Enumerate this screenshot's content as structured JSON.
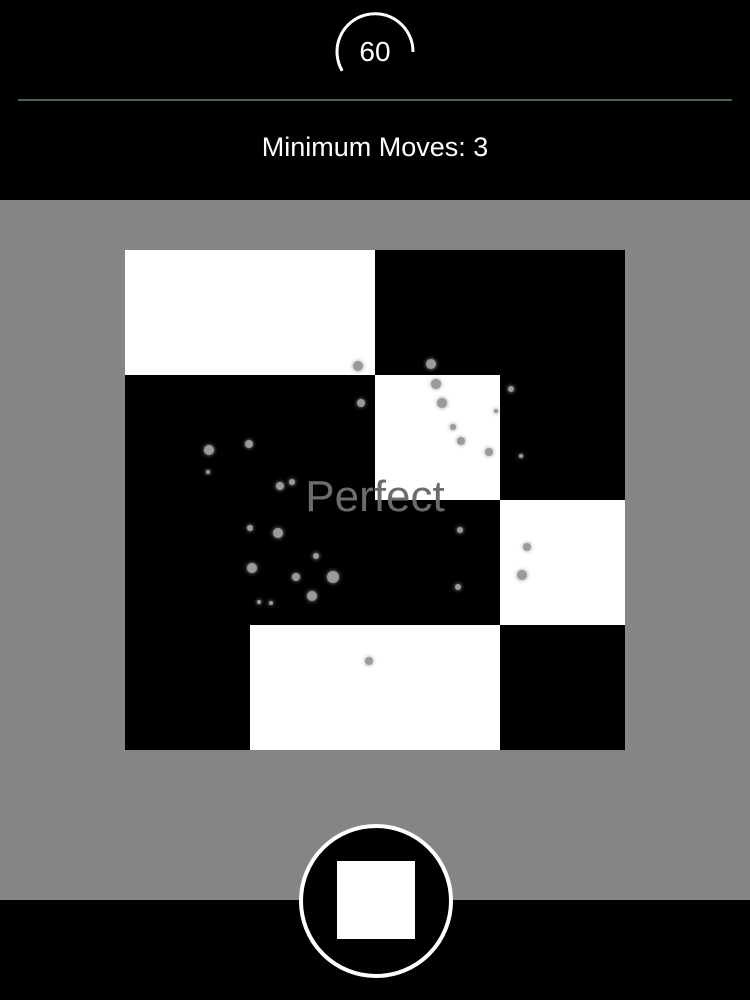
{
  "timer": {
    "value": "60",
    "ring_color": "#ffffff"
  },
  "header": {
    "min_moves_text": "Minimum Moves: 3",
    "divider_color": "#3f6660"
  },
  "board": {
    "rows": 4,
    "cols": 4,
    "cells": [
      [
        "white",
        "white",
        "black",
        "black"
      ],
      [
        "black",
        "black",
        "white",
        "black"
      ],
      [
        "black",
        "black",
        "black",
        "white"
      ],
      [
        "black",
        "white",
        "white",
        "black"
      ]
    ],
    "background_color": "#858486"
  },
  "feedback": {
    "text": "Perfect"
  },
  "action_button": {
    "icon": "square-icon"
  }
}
